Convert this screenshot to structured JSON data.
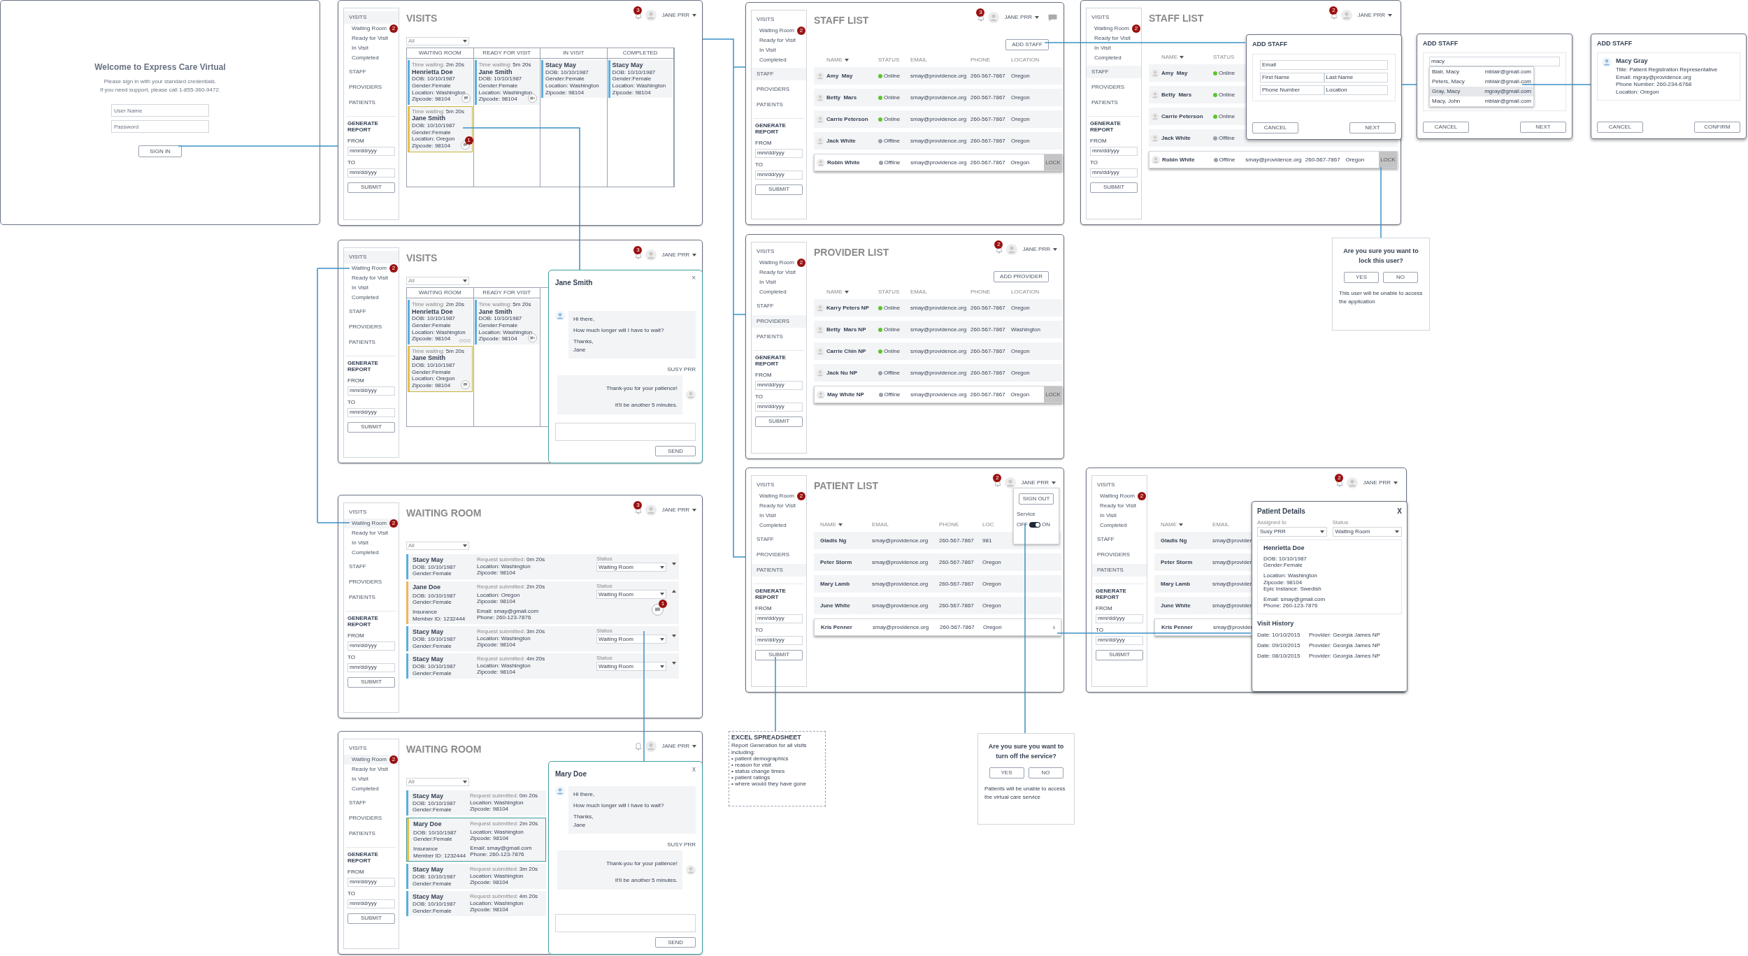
{
  "login": {
    "title": "Welcome to Express Care Virtual",
    "instructions": [
      "Please sign in with your standard credentials.",
      "If you need support, please call 1-855-360-9472."
    ],
    "username": {
      "placeholder": "User Name"
    },
    "password": {
      "placeholder": "Password"
    },
    "sign_in": "SIGN IN"
  },
  "visits_board": {
    "sidebar": {
      "items": [
        {
          "label": "VISITS",
          "kind": "section",
          "selected": true
        },
        {
          "label": "Waiting Room",
          "kind": "sub",
          "selected": false,
          "badge": "2"
        },
        {
          "label": "Ready for Visit",
          "kind": "sub",
          "selected": false
        },
        {
          "label": "In Visit",
          "kind": "sub",
          "selected": false
        },
        {
          "label": "Completed",
          "kind": "sub",
          "selected": false
        },
        {
          "label": "STAFF",
          "kind": "section",
          "selected": false
        },
        {
          "label": "PROVIDERS",
          "kind": "section",
          "selected": false
        },
        {
          "label": "PATIENTS",
          "kind": "section",
          "selected": false
        }
      ],
      "report": {
        "title": "GENERATE REPORT",
        "from_label": "FROM",
        "from_value": "mm/dd/yyy",
        "to_label": "TO",
        "to_value": "mm/dd/yyy",
        "submit": "SUBMIT"
      }
    },
    "header": {
      "title": "VISITS",
      "notifications": "3",
      "user": "JANE PRR"
    },
    "filter": "All",
    "columns": [
      {
        "title": "WAITING ROOM",
        "cards": [
          {
            "time_label": "Time waiting:",
            "time": "2m 20s",
            "name": "Henrietta Doe",
            "details": [
              "DOB: 10/10/1987 Gender:Female",
              "Location: Washington",
              "Zipcode: 98104"
            ],
            "kind": "chat",
            "selected": false
          },
          {
            "time_label": "Time waiting:",
            "time": "5m 20s",
            "name": "Jane Smith",
            "details": [
              "DOB: 10/10/1987 Gender:Female",
              "Location: Oregon",
              "Zipcode: 98104"
            ],
            "kind": "chat",
            "badge": "1",
            "selected": true
          }
        ]
      },
      {
        "title": "READY FOR VISIT",
        "cards": [
          {
            "time_label": "Time waiting:",
            "time": "5m 20s",
            "name": "Jane Smith",
            "details": [
              "DOB: 10/10/1987 Gender:Female",
              "Location: Washington",
              "Zipcode: 98104"
            ],
            "kind": "video",
            "selected": false
          }
        ]
      },
      {
        "title": "IN VISIT",
        "cards": [
          {
            "name": "Stacy May",
            "details": [
              "DOB: 10/10/1987 Gender:Female",
              "Location: Washington",
              "Zipcode: 98104"
            ],
            "kind": "plain",
            "selected": false
          }
        ]
      },
      {
        "title": "COMPLETED",
        "cards": [
          {
            "name": "Stacy May",
            "details": [
              "DOB: 10/10/1987 Gender:Female",
              "Location: Washington",
              "Zipcode: 98104"
            ],
            "kind": "plain",
            "selected": false
          }
        ]
      }
    ]
  },
  "visits_chat": {
    "sidebar": {
      "items": [
        {
          "label": "VISITS",
          "kind": "section",
          "selected": true
        },
        {
          "label": "Waiting Room",
          "kind": "sub",
          "selected": false,
          "badge": "2"
        },
        {
          "label": "Ready for Visit",
          "kind": "sub",
          "selected": false
        },
        {
          "label": "In Visit",
          "kind": "sub",
          "selected": false
        },
        {
          "label": "Completed",
          "kind": "sub",
          "selected": false
        },
        {
          "label": "STAFF",
          "kind": "section",
          "selected": false
        },
        {
          "label": "PROVIDERS",
          "kind": "section",
          "selected": false
        },
        {
          "label": "PATIENTS",
          "kind": "section",
          "selected": false
        }
      ],
      "report": {
        "title": "GENERATE REPORT",
        "from_label": "FROM",
        "from_value": "mm/dd/yyy",
        "to_label": "TO",
        "to_value": "mm/dd/yyy",
        "submit": "SUBMIT"
      }
    },
    "header": {
      "title": "VISITS",
      "notifications": "3",
      "user": "JANE PRR"
    },
    "filter": "All",
    "columns": [
      {
        "title": "WAITING ROOM",
        "cards": [
          {
            "time_label": "Time waiting:",
            "time": "2m 20s",
            "name": "Henrietta Doe",
            "details": [
              "DOB: 10/10/1987 Gender:Female",
              "Location: Washington",
              "Zipcode: 98104"
            ],
            "kind": "typing",
            "selected": false
          },
          {
            "time_label": "Time waiting:",
            "time": "5m 20s",
            "name": "Jane Smith",
            "details": [
              "DOB: 10/10/1987 Gender:Female",
              "Location: Oregon",
              "Zipcode: 98104"
            ],
            "kind": "chat",
            "selected": true
          }
        ]
      },
      {
        "title": "READY FOR VISIT",
        "cards": [
          {
            "time_label": "Time waiting:",
            "time": "5m 20s",
            "name": "Jane Smith",
            "details": [
              "DOB: 10/10/1987 Gender:Female",
              "Location: Washington",
              "Zipcode: 98104"
            ],
            "kind": "video",
            "selected": false
          }
        ]
      }
    ],
    "chat": {
      "name": "Jane Smith",
      "close": "×",
      "incoming": [
        "Hi there,",
        "How much longer will I have to wait?",
        "Thanks,\nJane"
      ],
      "sender": "SUSY PRR",
      "outgoing": "Thank-you for your patience!\nIt'll be another 5 minutes.",
      "send": "SEND"
    }
  },
  "waiting_room": {
    "sidebar": {
      "items": [
        {
          "label": "VISITS",
          "kind": "section",
          "selected": false
        },
        {
          "label": "Waiting Room",
          "kind": "sub",
          "selected": true,
          "badge": "2"
        },
        {
          "label": "Ready for Visit",
          "kind": "sub",
          "selected": false
        },
        {
          "label": "In Visit",
          "kind": "sub",
          "selected": false
        },
        {
          "label": "Completed",
          "kind": "sub",
          "selected": false
        },
        {
          "label": "STAFF",
          "kind": "section",
          "selected": false
        },
        {
          "label": "PROVIDERS",
          "kind": "section",
          "selected": false
        },
        {
          "label": "PATIENTS",
          "kind": "section",
          "selected": false
        }
      ],
      "report": {
        "title": "GENERATE REPORT",
        "from_label": "FROM",
        "from_value": "mm/dd/yyy",
        "to_label": "TO",
        "to_value": "mm/dd/yyy",
        "submit": "SUBMIT"
      }
    },
    "header": {
      "title": "WAITING ROOM",
      "notifications": "3",
      "user": "JANE PRR"
    },
    "filter": "All",
    "entries": [
      {
        "name": "Stacy May",
        "time_label": "Request submitted:",
        "time": "0m 20s",
        "dob": "DOB: 10/10/1987",
        "gender": "Gender:Female",
        "location": "Location: Washington",
        "zipcode": "Zipcode: 98104",
        "status_label": "Status",
        "status": "Waiting Room",
        "color": "#5aaee0",
        "expanded": false,
        "selected": false
      },
      {
        "name": "Jane Doe",
        "time_label": "Request submitted:",
        "time": "2m 20s",
        "dob": "DOB: 10/10/1987",
        "gender": "Gender:Female",
        "location": "Location: Oregon",
        "zipcode": "Zipcode: 98104",
        "insurance": "Insurance",
        "member_id": "Member ID: 1232444",
        "email": "Email: smay@gmail.com",
        "phone": "Phone: 260-123-7876",
        "status_label": "Status",
        "status": "Waiting Room",
        "chat_badge": "1",
        "color": "#f0b45a",
        "expanded": true,
        "selected": false
      },
      {
        "name": "Stacy May",
        "time_label": "Request submitted:",
        "time": "3m 20s",
        "dob": "DOB: 10/10/1987",
        "gender": "Gender:Female",
        "location": "Location: Washington",
        "zipcode": "Zipcode: 98104",
        "status_label": "Status",
        "status": "Waiting Room",
        "color": "#5aaee0",
        "expanded": false,
        "selected": false
      },
      {
        "name": "Stacy May",
        "time_label": "Request submitted:",
        "time": "4m 20s",
        "dob": "DOB: 10/10/1987",
        "gender": "Gender:Female",
        "location": "Location: Washington",
        "zipcode": "Zipcode: 98104",
        "status_label": "Status",
        "status": "Waiting Room",
        "color": "#5aaee0",
        "expanded": false,
        "selected": false
      }
    ]
  },
  "waiting_room_chat": {
    "sidebar": {
      "items": [
        {
          "label": "VISITS",
          "kind": "section",
          "selected": false
        },
        {
          "label": "Waiting Room",
          "kind": "sub",
          "selected": true,
          "badge": "2"
        },
        {
          "label": "Ready for Visit",
          "kind": "sub",
          "selected": false
        },
        {
          "label": "In Visit",
          "kind": "sub",
          "selected": false
        },
        {
          "label": "Completed",
          "kind": "sub",
          "selected": false
        },
        {
          "label": "STAFF",
          "kind": "section",
          "selected": false
        },
        {
          "label": "PROVIDERS",
          "kind": "section",
          "selected": false
        },
        {
          "label": "PATIENTS",
          "kind": "section",
          "selected": false
        }
      ],
      "report": {
        "title": "GENERATE REPORT",
        "from_label": "FROM",
        "from_value": "mm/dd/yyy",
        "to_label": "TO",
        "to_value": "mm/dd/yyy",
        "submit": "SUBMIT"
      }
    },
    "header": {
      "title": "WAITING ROOM",
      "user": "JANE PRR"
    },
    "filter": "All",
    "entries": [
      {
        "name": "Stacy May",
        "time_label": "Request submitted:",
        "time": "0m 20s",
        "dob": "DOB: 10/10/1987",
        "gender": "Gender:Female",
        "location": "Location: Washington",
        "zipcode": "Zipcode: 98104",
        "color": "#5aaee0",
        "expanded": false,
        "selected": false
      },
      {
        "name": "Mary Doe",
        "time_label": "Request submitted:",
        "time": "2m 20s",
        "dob": "DOB: 10/10/1987",
        "gender": "Gender:Female",
        "location": "Location: Washington",
        "zipcode": "Zipcode: 98104",
        "insurance": "Insurance",
        "member_id": "Member ID: 1232444",
        "email": "Email: smay@gmail.com",
        "phone": "Phone: 260-123-7876",
        "color": "#e8c14a",
        "expanded": true,
        "selected": true
      },
      {
        "name": "Stacy May",
        "time_label": "Request submitted:",
        "time": "3m 20s",
        "dob": "DOB: 10/10/1987",
        "gender": "Gender:Female",
        "location": "Location: Washington",
        "zipcode": "Zipcode: 98104",
        "color": "#5aaee0",
        "expanded": false,
        "selected": false
      },
      {
        "name": "Stacy May",
        "time_label": "Request submitted:",
        "time": "4m 20s",
        "dob": "DOB: 10/10/1987",
        "gender": "Gender:Female",
        "location": "Location: Washington",
        "zipcode": "Zipcode: 98104",
        "color": "#5aaee0",
        "expanded": false,
        "selected": false
      }
    ],
    "chat": {
      "name": "Mary Doe",
      "close": "x",
      "incoming": [
        "Hi there,",
        "How much longer will I have to wait?",
        "Thanks,\nJane"
      ],
      "sender": "SUSY PRR",
      "outgoing": "Thank-you for your patience!\nIt'll be another 5 minutes.",
      "send": "SEND"
    }
  },
  "staff_list": {
    "sidebar": {
      "items": [
        {
          "label": "VISITS",
          "kind": "section",
          "selected": false
        },
        {
          "label": "Waiting Room",
          "kind": "sub",
          "selected": false,
          "badge": "2"
        },
        {
          "label": "Ready for Visit",
          "kind": "sub",
          "selected": false
        },
        {
          "label": "In Visit",
          "kind": "sub",
          "selected": false
        },
        {
          "label": "Completed",
          "kind": "sub",
          "selected": false
        },
        {
          "label": "STAFF",
          "kind": "section",
          "selected": true
        },
        {
          "label": "PROVIDERS",
          "kind": "section",
          "selected": false
        },
        {
          "label": "PATIENTS",
          "kind": "section",
          "selected": false
        }
      ],
      "report": {
        "title": "GENERATE REPORT",
        "from_label": "FROM",
        "from_value": "mm/dd/yyy",
        "to_label": "TO",
        "to_value": "mm/dd/yyy",
        "submit": "SUBMIT"
      }
    },
    "header": {
      "title": "STAFF LIST",
      "notifications": "3",
      "user": "JANE PRR",
      "messages": true
    },
    "add_button": "ADD STAFF",
    "table": {
      "kind": "status",
      "columns": [
        {
          "label": "NAME",
          "sorted": true
        },
        {
          "label": "STATUS",
          "sorted": false
        },
        {
          "label": "EMAIL",
          "sorted": false
        },
        {
          "label": "PHONE",
          "sorted": false
        },
        {
          "label": "LOCATION",
          "sorted": false
        }
      ],
      "lock": "LOCK",
      "rows": [
        {
          "name": "Amy  May",
          "status": "Online",
          "online": true,
          "email": "smay@providence.org",
          "phone": "260-567-7867",
          "location": "Oregon",
          "selected": false
        },
        {
          "name": "Betty  Mars",
          "status": "Online",
          "online": true,
          "email": "smay@providence.org",
          "phone": "260-567-7867",
          "location": "Oregon",
          "selected": false
        },
        {
          "name": "Carrie Peterson",
          "status": "Online",
          "online": true,
          "email": "smay@providence.org",
          "phone": "260-567-7867",
          "location": "Oregon",
          "selected": false
        },
        {
          "name": "Jack White",
          "status": "Offline",
          "online": false,
          "email": "smay@providence.org",
          "phone": "260-567-7867",
          "location": "Oregon",
          "selected": false
        },
        {
          "name": "Robin White",
          "status": "Offline",
          "online": false,
          "email": "smay@providence.org",
          "phone": "260-567-7867",
          "location": "Oregon",
          "selected": true
        }
      ]
    }
  },
  "provider_list": {
    "sidebar": {
      "items": [
        {
          "label": "VISITS",
          "kind": "section",
          "selected": false
        },
        {
          "label": "Waiting Room",
          "kind": "sub",
          "selected": false,
          "badge": "2"
        },
        {
          "label": "Ready for Visit",
          "kind": "sub",
          "selected": false
        },
        {
          "label": "In Visit",
          "kind": "sub",
          "selected": false
        },
        {
          "label": "Completed",
          "kind": "sub",
          "selected": false
        },
        {
          "label": "STAFF",
          "kind": "section",
          "selected": false
        },
        {
          "label": "PROVIDERS",
          "kind": "section",
          "selected": true
        },
        {
          "label": "PATIENTS",
          "kind": "section",
          "selected": false
        }
      ],
      "report": {
        "title": "GENERATE REPORT",
        "from_label": "FROM",
        "from_value": "mm/dd/yyy",
        "to_label": "TO",
        "to_value": "mm/dd/yyy",
        "submit": "SUBMIT"
      }
    },
    "header": {
      "title": "PROVIDER LIST",
      "notifications": "2",
      "user": "JANE PRR"
    },
    "add_button": "ADD PROVIDER",
    "table": {
      "kind": "status",
      "columns": [
        {
          "label": "NAME",
          "sorted": true
        },
        {
          "label": "STATUS",
          "sorted": false
        },
        {
          "label": "EMAIL",
          "sorted": false
        },
        {
          "label": "PHONE",
          "sorted": false
        },
        {
          "label": "LOCATION",
          "sorted": false
        }
      ],
      "lock": "LOCK",
      "rows": [
        {
          "name": "Karry Peters NP",
          "status": "Online",
          "online": true,
          "email": "smay@providence.org",
          "phone": "260-567-7867",
          "location": "Oregon",
          "selected": false
        },
        {
          "name": "Betty  Mars NP",
          "status": "Online",
          "online": true,
          "email": "smay@providence.org",
          "phone": "260-567-7867",
          "location": "Washington",
          "selected": false
        },
        {
          "name": "Carrie Chin NP",
          "status": "Online",
          "online": true,
          "email": "smay@providence.org",
          "phone": "260-567-7867",
          "location": "Oregon",
          "selected": false
        },
        {
          "name": "Jack Nu NP",
          "status": "Offline",
          "online": false,
          "email": "smay@providence.org",
          "phone": "260-567-7867",
          "location": "Oregon",
          "selected": false
        },
        {
          "name": "May White NP",
          "status": "Offline",
          "online": false,
          "email": "smay@providence.org",
          "phone": "260-567-7867",
          "location": "Oregon",
          "selected": true
        }
      ]
    }
  },
  "patient_list": {
    "sidebar": {
      "items": [
        {
          "label": "VISITS",
          "kind": "section",
          "selected": false
        },
        {
          "label": "Waiting Room",
          "kind": "sub",
          "selected": false,
          "badge": "2"
        },
        {
          "label": "Ready for Visit",
          "kind": "sub",
          "selected": false
        },
        {
          "label": "In Visit",
          "kind": "sub",
          "selected": false
        },
        {
          "label": "Completed",
          "kind": "sub",
          "selected": false
        },
        {
          "label": "STAFF",
          "kind": "section",
          "selected": false
        },
        {
          "label": "PROVIDERS",
          "kind": "section",
          "selected": false
        },
        {
          "label": "PATIENTS",
          "kind": "section",
          "selected": true
        }
      ],
      "report": {
        "title": "GENERATE REPORT",
        "from_label": "FROM",
        "from_value": "mm/dd/yyy",
        "to_label": "TO",
        "to_value": "mm/dd/yyy",
        "submit": "SUBMIT"
      }
    },
    "header": {
      "title": "PATIENT LIST",
      "notifications": "2",
      "user": "JANE PRR"
    },
    "user_menu": {
      "sign_out": "SIGN OUT",
      "service_label": "Service",
      "off": "OFF",
      "on_label": "ON",
      "on": true
    },
    "table": {
      "kind": "contact",
      "columns": [
        {
          "label": "NAME",
          "sorted": true
        },
        {
          "label": "EMAIL",
          "sorted": false
        },
        {
          "label": "PHONE",
          "sorted": false
        },
        {
          "label": "LOC",
          "sorted": false
        }
      ],
      "open_indicator": "›",
      "rows": [
        {
          "name": "Gladis Ng",
          "email": "smay@providence.org",
          "phone": "260-567-7867",
          "location": "981",
          "selected": false
        },
        {
          "name": "Peter Storm",
          "email": "smay@providence.org",
          "phone": "260-567-7867",
          "location": "Oregon",
          "selected": false
        },
        {
          "name": "Mary Lamb",
          "email": "smay@providence.org",
          "phone": "260-567-7867",
          "location": "Oregon",
          "selected": false
        },
        {
          "name": "June White",
          "email": "smay@providence.org",
          "phone": "260-567-7867",
          "location": "Oregon",
          "selected": false
        },
        {
          "name": "Kris Penner",
          "email": "smay@providence.org",
          "phone": "260-567-7867",
          "location": "Oregon",
          "selected": true
        }
      ]
    }
  },
  "staff_list_adding": {
    "sidebar": {
      "items": [
        {
          "label": "VISITS",
          "kind": "section",
          "selected": false
        },
        {
          "label": "Waiting Room",
          "kind": "sub",
          "selected": false,
          "badge": "2"
        },
        {
          "label": "Ready for Visit",
          "kind": "sub",
          "selected": false
        },
        {
          "label": "In Visit",
          "kind": "sub",
          "selected": false
        },
        {
          "label": "Completed",
          "kind": "sub",
          "selected": false
        },
        {
          "label": "STAFF",
          "kind": "section",
          "selected": true
        },
        {
          "label": "PROVIDERS",
          "kind": "section",
          "selected": false
        },
        {
          "label": "PATIENTS",
          "kind": "section",
          "selected": false
        }
      ],
      "report": {
        "title": "GENERATE REPORT",
        "from_label": "FROM",
        "from_value": "mm/dd/yyy",
        "to_label": "TO",
        "to_value": "mm/dd/yyy",
        "submit": "SUBMIT"
      }
    },
    "header": {
      "title": "STAFF LIST",
      "notifications": "2",
      "user": "JANE PRR"
    },
    "table": {
      "kind": "status",
      "columns": [
        {
          "label": "NAME",
          "sorted": true
        },
        {
          "label": "STATUS",
          "sorted": false
        }
      ],
      "lock": "LOCK",
      "rows": [
        {
          "name": "Amy  May",
          "status": "Online",
          "online": true,
          "selected": false
        },
        {
          "name": "Betty  Mars",
          "status": "Online",
          "online": true,
          "selected": false
        },
        {
          "name": "Carrie Peterson",
          "status": "Online",
          "online": true,
          "selected": false
        },
        {
          "name": "Jack White",
          "status": "Offline",
          "online": false,
          "selected": false
        },
        {
          "name": "Robin White",
          "status": "Offline",
          "online": false,
          "email": "smay@providence.org",
          "phone": "260-567-7867",
          "location": "Oregon",
          "selected": true
        }
      ]
    },
    "add_staff": {
      "title": "ADD STAFF",
      "fields": [
        {
          "placeholder": "Email"
        },
        {
          "placeholder": "First Name"
        },
        {
          "placeholder": "Last Name"
        },
        {
          "placeholder": "Phone Number"
        },
        {
          "placeholder": "Location"
        }
      ],
      "cancel": "CANCEL",
      "next": "NEXT"
    }
  },
  "add_staff_search": {
    "title": "ADD STAFF",
    "search": {
      "value": "macy"
    },
    "suggestions": [
      {
        "name": "Blair, Macy",
        "email": "mblair@gmail.com",
        "selected": false
      },
      {
        "name": "Peters, Macy",
        "email": "mblair@gmail.com",
        "selected": false
      },
      {
        "name": "Gray, Macy",
        "email": "mgray@gmail.com",
        "selected": true
      },
      {
        "name": "Macy, John",
        "email": "mblair@gmail.com",
        "selected": false
      }
    ],
    "cancel": "CANCEL",
    "next": "NEXT"
  },
  "add_staff_confirm": {
    "title": "ADD STAFF",
    "card": {
      "name": "Macy Gray",
      "lines": [
        "Title: Patient Registration Representative",
        "Email: mgray@providence.org",
        "Phone Number: 260-234-6768",
        "Location: Oregon"
      ]
    },
    "cancel": "CANCEL",
    "confirm": "CONFIRM"
  },
  "lock_dialog": {
    "question": "Are you sure you want to lock this user?",
    "yes": "YES",
    "no": "NO",
    "note": "This user will be unable to access the application"
  },
  "patient_details_view": {
    "sidebar": {
      "items": [
        {
          "label": "VISITS",
          "kind": "section",
          "selected": false
        },
        {
          "label": "Waiting Room",
          "kind": "sub",
          "selected": false,
          "badge": "2"
        },
        {
          "label": "Ready for Visit",
          "kind": "sub",
          "selected": false
        },
        {
          "label": "In Visit",
          "kind": "sub",
          "selected": false
        },
        {
          "label": "Completed",
          "kind": "sub",
          "selected": false
        },
        {
          "label": "STAFF",
          "kind": "section",
          "selected": false
        },
        {
          "label": "PROVIDERS",
          "kind": "section",
          "selected": false
        },
        {
          "label": "PATIENTS",
          "kind": "section",
          "selected": true
        }
      ],
      "report": {
        "title": "GENERATE REPORT",
        "from_label": "FROM",
        "from_value": "mm/dd/yyy",
        "to_label": "TO",
        "to_value": "mm/dd/yyy",
        "submit": "SUBMIT"
      }
    },
    "header": {
      "notifications": "2",
      "user": "JANE PRR"
    },
    "table": {
      "kind": "contact",
      "columns": [
        {
          "label": "NAME",
          "sorted": true
        },
        {
          "label": "EMAIL",
          "sorted": false
        }
      ],
      "rows": [
        {
          "name": "Gladis Ng",
          "email": "smay@provider",
          "selected": false
        },
        {
          "name": "Peter Storm",
          "email": "smay@provider",
          "selected": false
        },
        {
          "name": "Mary Lamb",
          "email": "smay@provider",
          "selected": false
        },
        {
          "name": "June White",
          "email": "smay@provider",
          "selected": false
        },
        {
          "name": "Kris Penner",
          "email": "smay@provider",
          "selected": true
        }
      ]
    },
    "details": {
      "title": "Patient Details",
      "close": "X",
      "assigned_label": "Assigned to",
      "assigned": "Susy PRR",
      "status_label": "Status",
      "status": "Waiting Room",
      "name": "Henrietta Doe",
      "groups": [
        [
          "DOB: 10/10/1987",
          "Gender:Female"
        ],
        [
          "Location: Washington",
          "Zipcode: 98104",
          "Epic Instance: Swedish"
        ],
        [
          "Email: smay@gmail.com",
          "Phone: 260-123-7876"
        ]
      ],
      "history_title": "Visit History",
      "history": [
        {
          "date": "Date: 10/10/2015",
          "provider": "Provider: Georgia James NP"
        },
        {
          "date": "Date: 09/10/2015",
          "provider": "Provider: Georgia James NP"
        },
        {
          "date": "Date: 08/10/2015",
          "provider": "Provider: Georgia James NP"
        }
      ]
    }
  },
  "excel_note": {
    "title": "EXCEL SPREADSHEET",
    "intro": "Report Generation for all visits including:",
    "bullets": [
      "• patient demographics",
      "• reason for visit",
      "• status change times",
      "• patient ratings",
      "• where would they have gone"
    ]
  },
  "service_dialog": {
    "question": "Are you sure you want to turn off the service?",
    "yes": "YES",
    "no": "NO",
    "note": "Patients will be unable to access the virtual care service"
  }
}
